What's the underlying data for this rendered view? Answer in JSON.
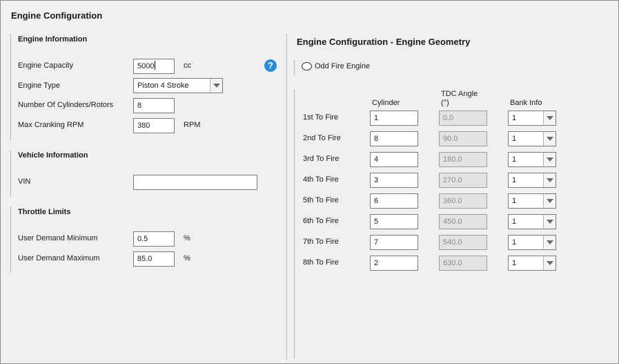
{
  "window_title": "Engine Configuration",
  "engine_info": {
    "header": "Engine Information",
    "capacity_label": "Engine Capacity",
    "capacity_value": "5000",
    "capacity_unit": "cc",
    "type_label": "Engine Type",
    "type_value": "Piston 4 Stroke",
    "cylinders_label": "Number Of Cylinders/Rotors",
    "cylinders_value": "8",
    "cranking_label": "Max Cranking RPM",
    "cranking_value": "380",
    "cranking_unit": "RPM",
    "help_glyph": "?"
  },
  "vehicle_info": {
    "header": "Vehicle Information",
    "vin_label": "VIN",
    "vin_value": ""
  },
  "throttle_limits": {
    "header": "Throttle Limits",
    "min_label": "User Demand Minimum",
    "min_value": "0.5",
    "min_unit": "%",
    "max_label": "User Demand Maximum",
    "max_value": "85.0",
    "max_unit": "%"
  },
  "geometry": {
    "title": "Engine Configuration - Engine Geometry",
    "odd_fire_label": "Odd Fire Engine",
    "col_cylinder": "Cylinder",
    "col_tdc": "TDC Angle\n(°)",
    "col_bank": "Bank Info",
    "rows": [
      {
        "label": "1st To Fire",
        "cylinder": "1",
        "tdc": "0.0",
        "bank": "1"
      },
      {
        "label": "2nd To Fire",
        "cylinder": "8",
        "tdc": "90.0",
        "bank": "1"
      },
      {
        "label": "3rd To Fire",
        "cylinder": "4",
        "tdc": "180.0",
        "bank": "1"
      },
      {
        "label": "4th To Fire",
        "cylinder": "3",
        "tdc": "270.0",
        "bank": "1"
      },
      {
        "label": "5th To Fire",
        "cylinder": "6",
        "tdc": "360.0",
        "bank": "1"
      },
      {
        "label": "6th To Fire",
        "cylinder": "5",
        "tdc": "450.0",
        "bank": "1"
      },
      {
        "label": "7th To Fire",
        "cylinder": "7",
        "tdc": "540.0",
        "bank": "1"
      },
      {
        "label": "8th To Fire",
        "cylinder": "2",
        "tdc": "630.0",
        "bank": "1"
      }
    ]
  },
  "colors": {
    "background": "#f0f0f0",
    "help_icon": "#2b8cd8",
    "readonly_field": "#e3e3e3"
  }
}
